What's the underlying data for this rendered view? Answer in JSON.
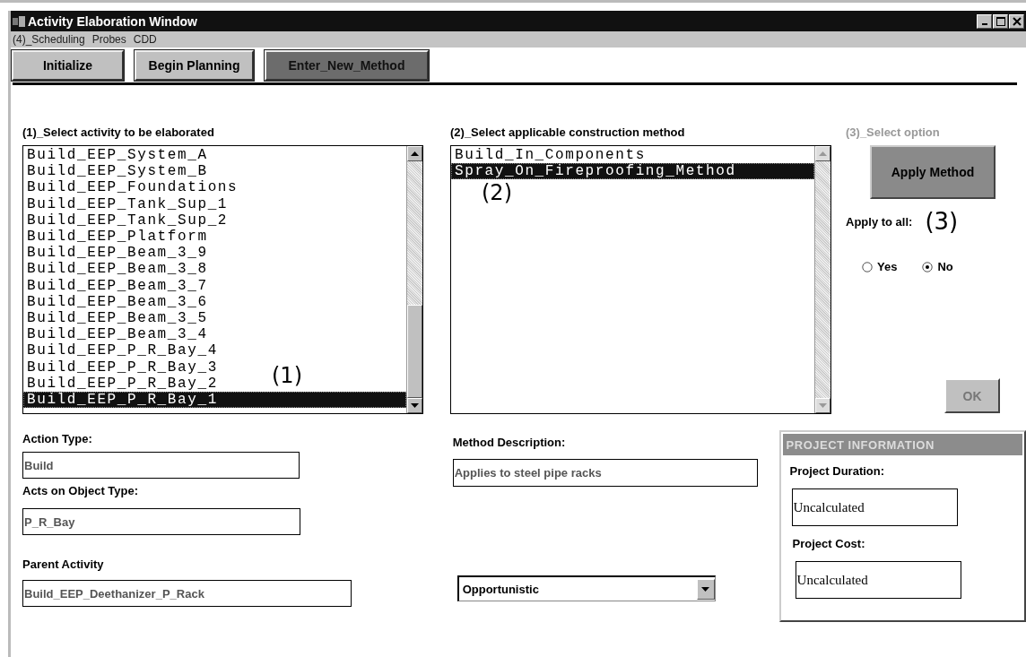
{
  "window": {
    "title": "Activity Elaboration Window"
  },
  "menu": [
    "(4)_Scheduling",
    "Probes",
    "CDD"
  ],
  "toolbar": [
    {
      "label": "Initialize",
      "active": false
    },
    {
      "label": "Begin Planning",
      "active": false
    },
    {
      "label": "Enter_New_Method",
      "active": true
    }
  ],
  "activity_panel": {
    "title": "(1)_Select activity to be elaborated",
    "marker": "(1)",
    "items": [
      {
        "label": "Build_EEP_System_A",
        "selected": false
      },
      {
        "label": "Build_EEP_System_B",
        "selected": false
      },
      {
        "label": "Build_EEP_Foundations",
        "selected": false
      },
      {
        "label": "Build_EEP_Tank_Sup_1",
        "selected": false
      },
      {
        "label": "Build_EEP_Tank_Sup_2",
        "selected": false
      },
      {
        "label": "Build_EEP_Platform",
        "selected": false
      },
      {
        "label": "Build_EEP_Beam_3_9",
        "selected": false
      },
      {
        "label": "Build_EEP_Beam_3_8",
        "selected": false
      },
      {
        "label": "Build_EEP_Beam_3_7",
        "selected": false
      },
      {
        "label": "Build_EEP_Beam_3_6",
        "selected": false
      },
      {
        "label": "Build_EEP_Beam_3_5",
        "selected": false
      },
      {
        "label": "Build_EEP_Beam_3_4",
        "selected": false
      },
      {
        "label": "Build_EEP_P_R_Bay_4",
        "selected": false
      },
      {
        "label": "Build_EEP_P_R_Bay_3",
        "selected": false
      },
      {
        "label": "Build_EEP_P_R_Bay_2",
        "selected": false
      },
      {
        "label": "Build_EEP_P_R_Bay_1",
        "selected": true
      }
    ]
  },
  "method_panel": {
    "title": "(2)_Select applicable construction method",
    "marker": "(2)",
    "items": [
      {
        "label": "Build_In_Components",
        "selected": false
      },
      {
        "label": "Spray_On_Fireproofing_Method",
        "selected": true
      }
    ]
  },
  "option_panel": {
    "title": "(3)_Select option",
    "title_disabled": true,
    "apply_button": "Apply Method",
    "apply_label": "Apply to all:",
    "marker": "(3)",
    "radios": [
      {
        "label": "Yes",
        "selected": false
      },
      {
        "label": "No",
        "selected": true
      }
    ],
    "ok_button": {
      "label": "OK",
      "disabled": true
    }
  },
  "details": [
    {
      "label": "Action Type:",
      "value": "Build"
    },
    {
      "label": "Acts on Object Type:",
      "value": "P_R_Bay"
    },
    {
      "label": "Parent Activity",
      "value": "Build_EEP_Deethanizer_P_Rack"
    }
  ],
  "method_description": {
    "label": "Method Description:",
    "value": "Applies to steel pipe racks"
  },
  "strategy_dropdown": {
    "value": "Opportunistic"
  },
  "project_information": {
    "title": "PROJECT INFORMATION",
    "fields": [
      {
        "label": "Project Duration:",
        "value": "Uncalculated"
      },
      {
        "label": "Project Cost:",
        "value": "Uncalculated"
      }
    ]
  }
}
